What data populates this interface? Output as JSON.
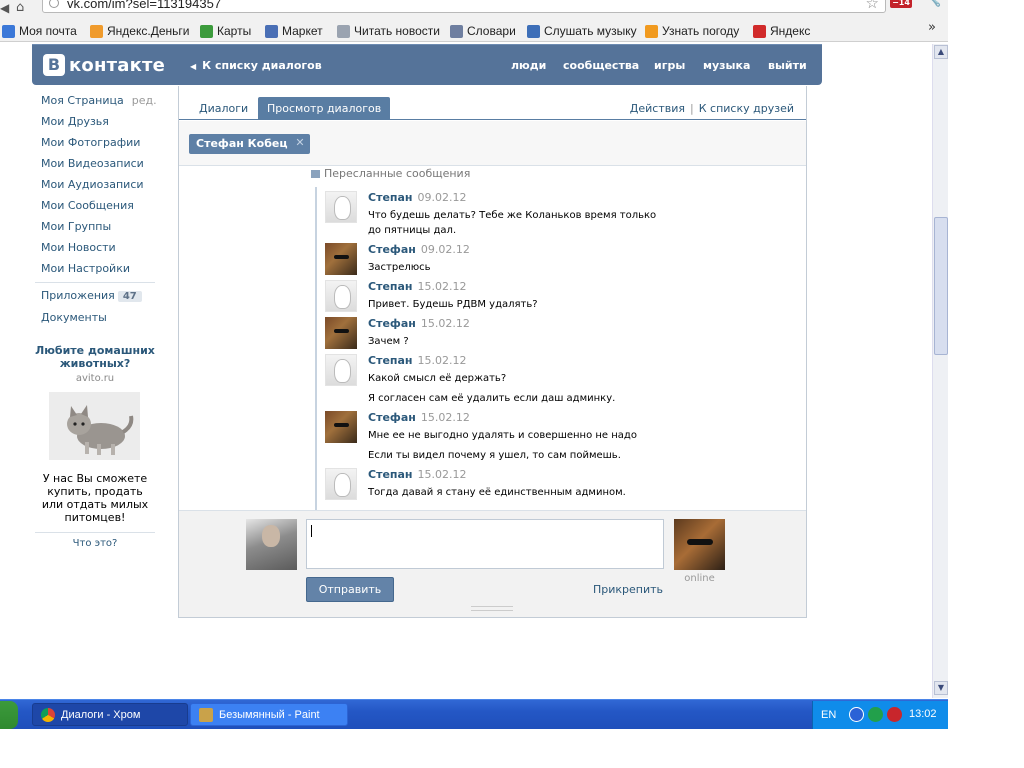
{
  "browser": {
    "url": "vk.com/im?sel=113194357",
    "badge": "14",
    "bookmarks": [
      {
        "label": "Моя почта",
        "color": "#3b78d8"
      },
      {
        "label": "Яндекс.Деньги",
        "color": "#f09b2c"
      },
      {
        "label": "Карты",
        "color": "#3c9b3c"
      },
      {
        "label": "Маркет",
        "color": "#4a6fb5"
      },
      {
        "label": "Читать новости",
        "color": "#9aa3b0"
      },
      {
        "label": "Словари",
        "color": "#6f7fa0"
      },
      {
        "label": "Слушать музыку",
        "color": "#3e6fb8"
      },
      {
        "label": "Узнать погоду",
        "color": "#f19a1f"
      },
      {
        "label": "Яндекс",
        "color": "#d12a2a"
      }
    ],
    "more": "»"
  },
  "header": {
    "logo_letter": "В",
    "logo_text": "контакте",
    "back_link": "К списку диалогов",
    "nav": [
      "люди",
      "сообщества",
      "игры",
      "музыка",
      "выйти"
    ]
  },
  "sidebar": {
    "items": [
      {
        "label": "Моя Страница",
        "extra": "ред."
      },
      {
        "label": "Мои Друзья"
      },
      {
        "label": "Мои Фотографии"
      },
      {
        "label": "Мои Видеозаписи"
      },
      {
        "label": "Мои Аудиозаписи"
      },
      {
        "label": "Мои Сообщения"
      },
      {
        "label": "Мои Группы"
      },
      {
        "label": "Мои Новости"
      },
      {
        "label": "Мои Настройки"
      }
    ],
    "apps_label": "Приложения",
    "apps_count": "47",
    "docs_label": "Документы",
    "ad": {
      "title": "Любите домашних животных?",
      "domain": "avito.ru",
      "text": "У нас Вы сможете купить, продать или отдать милых питомцев!",
      "what": "Что это?"
    }
  },
  "tabs": {
    "dialogs": "Диалоги",
    "view": "Просмотр диалогов",
    "actions": "Действия",
    "friends": "К списку друзей",
    "separator": "|"
  },
  "filter": {
    "chip": "Стефан Кобец",
    "chip_close": "✕"
  },
  "history": {
    "forwarded_label": "Пересланные сообщения",
    "messages": [
      {
        "who": "stepan",
        "name": "Степан",
        "date": "09.02.12",
        "text": "Что будешь делать? Тебе же Коланьков время только до пятницы дал."
      },
      {
        "who": "stefan",
        "name": "Стефан",
        "date": "09.02.12",
        "text": "Застрелюсь"
      },
      {
        "who": "stepan",
        "name": "Степан",
        "date": "15.02.12",
        "text": "Привет. Будешь РДВМ удалять?"
      },
      {
        "who": "stefan",
        "name": "Стефан",
        "date": "15.02.12",
        "text": "Зачем ?"
      },
      {
        "who": "stepan",
        "name": "Степан",
        "date": "15.02.12",
        "text": "Какой смысл её держать?",
        "text2": "Я согласен сам её удалить если даш админку."
      },
      {
        "who": "stefan",
        "name": "Стефан",
        "date": "15.02.12",
        "text": "Мне ее не выгодно удалять и совершенно не надо",
        "text2": "Если ты видел почему я ушел, то сам поймешь."
      },
      {
        "who": "stepan",
        "name": "Степан",
        "date": "15.02.12",
        "text": "Тогда давай я стану её единственным админом."
      }
    ]
  },
  "composer": {
    "send": "Отправить",
    "attach": "Прикрепить",
    "status": "online"
  },
  "taskbar": {
    "tasks": [
      {
        "label": "Диалоги - Хром",
        "active": true
      },
      {
        "label": "Безымянный - Paint",
        "active": false
      }
    ],
    "lang": "EN",
    "clock": "13:02"
  }
}
